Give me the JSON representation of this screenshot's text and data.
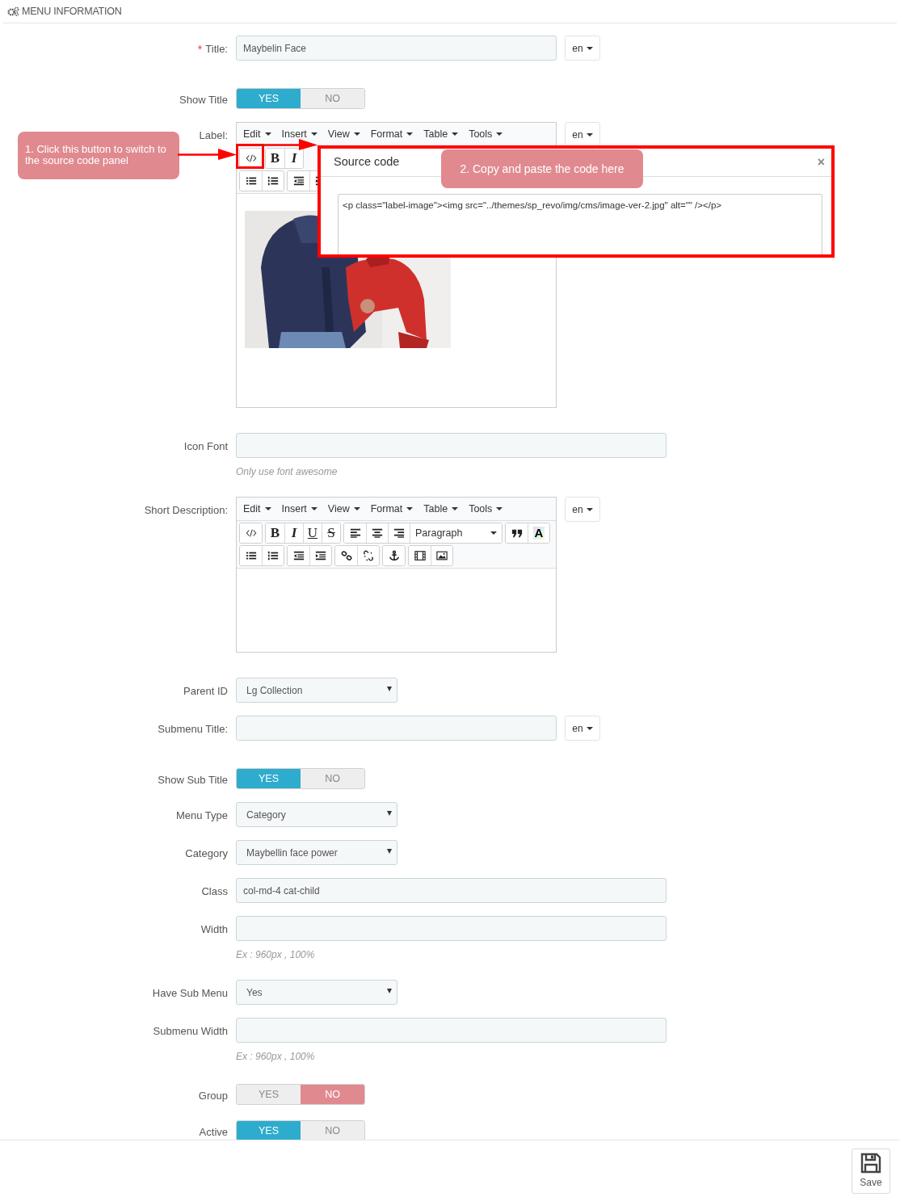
{
  "header": {
    "title": "MENU INFORMATION"
  },
  "fields": [
    {
      "kind": "text",
      "label": "Title:",
      "required_mark": "*",
      "value": "Maybelin Face",
      "lang": "en"
    },
    {
      "kind": "toggle",
      "label": "Show Title",
      "options": [
        {
          "label": "YES",
          "selected": true
        },
        {
          "label": "NO",
          "selected": false
        }
      ]
    },
    {
      "kind": "editor",
      "label": "Label:",
      "lang": "en",
      "menu": [
        "Edit",
        "Insert",
        "View",
        "Format",
        "Table",
        "Tools"
      ],
      "text_buttons": [
        "B",
        "I"
      ]
    },
    {
      "kind": "text",
      "label": "Icon Font",
      "hint": "Only use font awesome"
    },
    {
      "kind": "editor",
      "label": "Short Description:",
      "lang": "en",
      "menu": [
        "Edit",
        "Insert",
        "View",
        "Format",
        "Table",
        "Tools"
      ],
      "text_buttons": [
        "B",
        "I",
        "U",
        "S"
      ],
      "format_select": "Paragraph",
      "color_button": "A"
    },
    {
      "kind": "select",
      "label": "Parent ID",
      "value": "Lg Collection"
    },
    {
      "kind": "text",
      "label": "Submenu Title:",
      "lang": "en"
    },
    {
      "kind": "toggle",
      "label": "Show Sub Title",
      "options": [
        {
          "label": "YES",
          "selected": true
        },
        {
          "label": "NO",
          "selected": false
        }
      ]
    },
    {
      "kind": "select",
      "label": "Menu Type",
      "value": "Category"
    },
    {
      "kind": "select",
      "label": "Category",
      "value": "Maybellin face power"
    },
    {
      "kind": "text",
      "label": "Class",
      "value": "col-md-4 cat-child"
    },
    {
      "kind": "text",
      "label": "Width",
      "hint": "Ex : 960px , 100%"
    },
    {
      "kind": "select",
      "label": "Have Sub Menu",
      "value": "Yes"
    },
    {
      "kind": "text",
      "label": "Submenu Width",
      "hint": "Ex : 960px , 100%"
    },
    {
      "kind": "toggle",
      "label": "Group",
      "options": [
        {
          "label": "YES",
          "selected": false
        },
        {
          "label": "NO",
          "selected": true
        }
      ]
    },
    {
      "kind": "toggle",
      "label": "Active",
      "options": [
        {
          "label": "YES",
          "selected": true
        },
        {
          "label": "NO",
          "selected": false
        }
      ]
    }
  ],
  "source_code_dialog": {
    "title": "Source code",
    "close": "×",
    "code": "<p class=\"label-image\"><img src=\"../themes/sp_revo/img/cms/image-ver-2.jpg\" alt=\"\" /></p>"
  },
  "callouts": [
    {
      "text": "1. Click this button to switch to the source code panel"
    },
    {
      "text": "2. Copy and paste the code here"
    }
  ],
  "save_button": {
    "label": "Save"
  }
}
